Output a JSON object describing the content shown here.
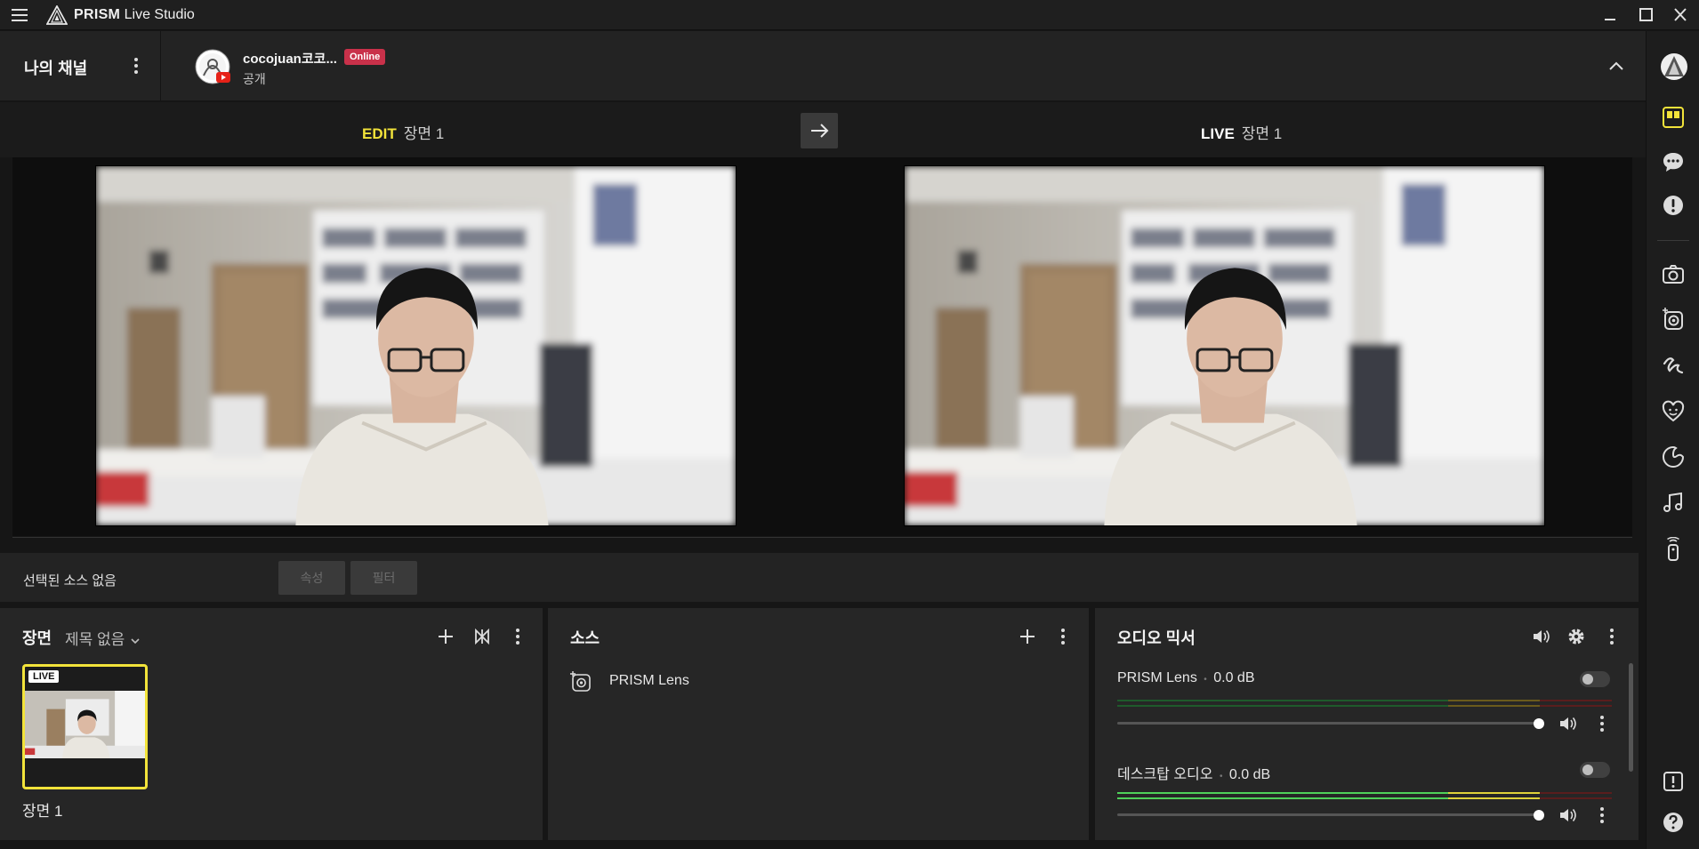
{
  "app": {
    "title_brand": "PRISM",
    "title_rest": "Live Studio",
    "icons": {
      "menu": "hamburger-icon",
      "logo": "prism-logo-icon",
      "minimize": "minimize-icon",
      "maximize": "maximize-icon",
      "close": "close-icon"
    }
  },
  "channel": {
    "section_title": "나의 채널",
    "name": "cocojuan코코...",
    "status_badge": "Online",
    "privacy": "공개",
    "colors": {
      "badge": "#c9314a",
      "youtube": "#e62117"
    }
  },
  "preview": {
    "edit_tag": "EDIT",
    "edit_scene": "장면 1",
    "live_tag": "LIVE",
    "live_scene": "장면 1",
    "colors": {
      "edit_tag": "#f2e33a",
      "live_tag": "#ffffff"
    }
  },
  "source_props": {
    "no_selection": "선택된 소스 없음",
    "properties_label": "속성",
    "filter_label": "필터"
  },
  "scenes_panel": {
    "title": "장면",
    "collection_name": "제목 없음",
    "live_chip": "LIVE",
    "items": [
      {
        "label": "장면 1"
      }
    ],
    "colors": {
      "active_border": "#f2e33a"
    }
  },
  "sources_panel": {
    "title": "소스",
    "items": [
      {
        "label": "PRISM Lens",
        "icon": "prism-lens-icon"
      }
    ]
  },
  "audio_mixer": {
    "title": "오디오 믹서",
    "channels": [
      {
        "name": "PRISM Lens",
        "db": "0.0 dB",
        "volume": 1.0
      },
      {
        "name": "데스크탑 오디오",
        "db": "0.0 dB",
        "volume": 1.0
      }
    ],
    "separator": "•"
  },
  "sidebar": {
    "items": [
      {
        "icon": "profile-avatar-icon"
      },
      {
        "icon": "layout-icon"
      },
      {
        "icon": "chat-icon"
      },
      {
        "icon": "alert-icon"
      },
      {
        "icon": "camera-icon"
      },
      {
        "icon": "lens-icon"
      },
      {
        "icon": "drawing-icon"
      },
      {
        "icon": "sticker-icon"
      },
      {
        "icon": "theme-icon"
      },
      {
        "icon": "music-icon"
      },
      {
        "icon": "remote-icon"
      },
      {
        "icon": "notice-icon"
      },
      {
        "icon": "help-icon"
      }
    ]
  }
}
